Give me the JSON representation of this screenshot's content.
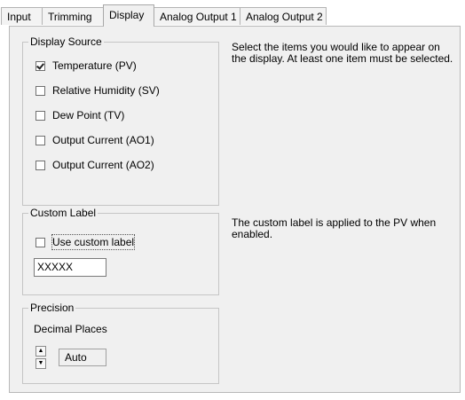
{
  "tabs": [
    {
      "label": "Input"
    },
    {
      "label": "Trimming"
    },
    {
      "label": "Display"
    },
    {
      "label": "Analog Output 1"
    },
    {
      "label": "Analog Output 2"
    }
  ],
  "display_source": {
    "title": "Display Source",
    "items": [
      {
        "label": "Temperature (PV)",
        "checked": true
      },
      {
        "label": "Relative Humidity (SV)",
        "checked": false
      },
      {
        "label": "Dew Point (TV)",
        "checked": false
      },
      {
        "label": "Output Current (AO1)",
        "checked": false
      },
      {
        "label": "Output Current (AO2)",
        "checked": false
      }
    ],
    "help_line1": "Select the items you would like to appear on",
    "help_line2": "the display. At least one item must be selected."
  },
  "custom_label": {
    "title": "Custom Label",
    "checkbox_label": "Use custom label",
    "checked": false,
    "value": "XXXXX",
    "help_line1": "The custom label is applied to the PV when",
    "help_line2": "enabled."
  },
  "precision": {
    "title": "Precision",
    "decimal_places_label": "Decimal Places",
    "value": "Auto",
    "up_icon": "triangle-up",
    "down_icon": "triangle-down"
  }
}
